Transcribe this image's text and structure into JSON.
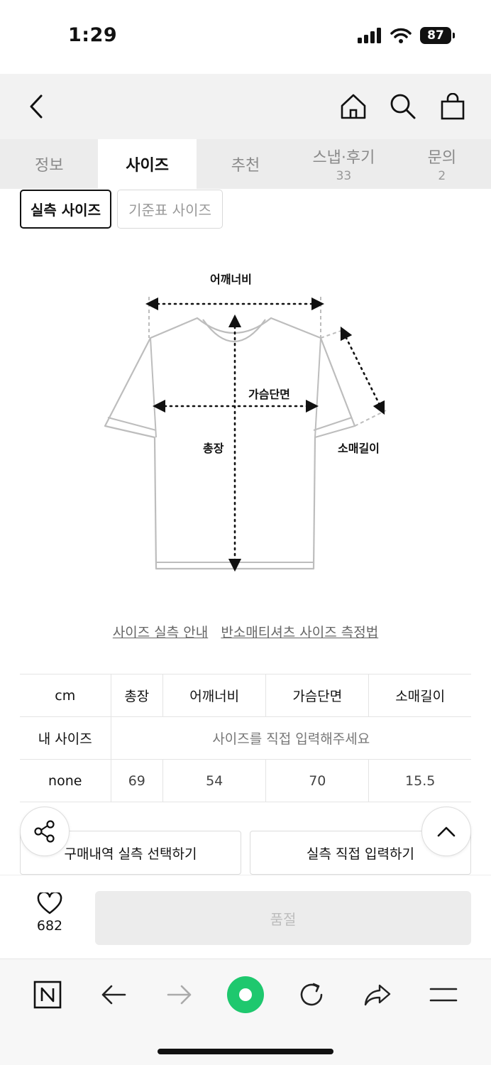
{
  "status": {
    "time": "1:29",
    "battery": "87"
  },
  "tabs": [
    {
      "label": "정보",
      "count": ""
    },
    {
      "label": "사이즈",
      "count": ""
    },
    {
      "label": "추천",
      "count": ""
    },
    {
      "label": "스냅·후기",
      "count": "33"
    },
    {
      "label": "문의",
      "count": "2"
    }
  ],
  "size_buttons": {
    "actual": "실측 사이즈",
    "standard": "기준표 사이즈"
  },
  "diagram": {
    "shoulder": "어깨너비",
    "chest": "가슴단면",
    "length": "총장",
    "sleeve": "소매길이"
  },
  "links": {
    "guide": "사이즈 실측 안내",
    "method": "반소매티셔츠 사이즈 측정법"
  },
  "table": {
    "header": [
      "cm",
      "총장",
      "어깨너비",
      "가슴단면",
      "소매길이"
    ],
    "my_size_label": "내 사이즈",
    "my_size_placeholder": "사이즈를 직접 입력해주세요",
    "row_label": "none",
    "row_values": [
      "69",
      "54",
      "70",
      "15.5"
    ]
  },
  "actions": {
    "history": "구매내역 실측 선택하기",
    "direct": "실측 직접 입력하기"
  },
  "purchase": {
    "likes": "682",
    "soldout": "품절"
  },
  "colors": {
    "accent_green": "#1ec800",
    "tab_bg": "#ececec",
    "header_bg": "#f2f2f2"
  }
}
